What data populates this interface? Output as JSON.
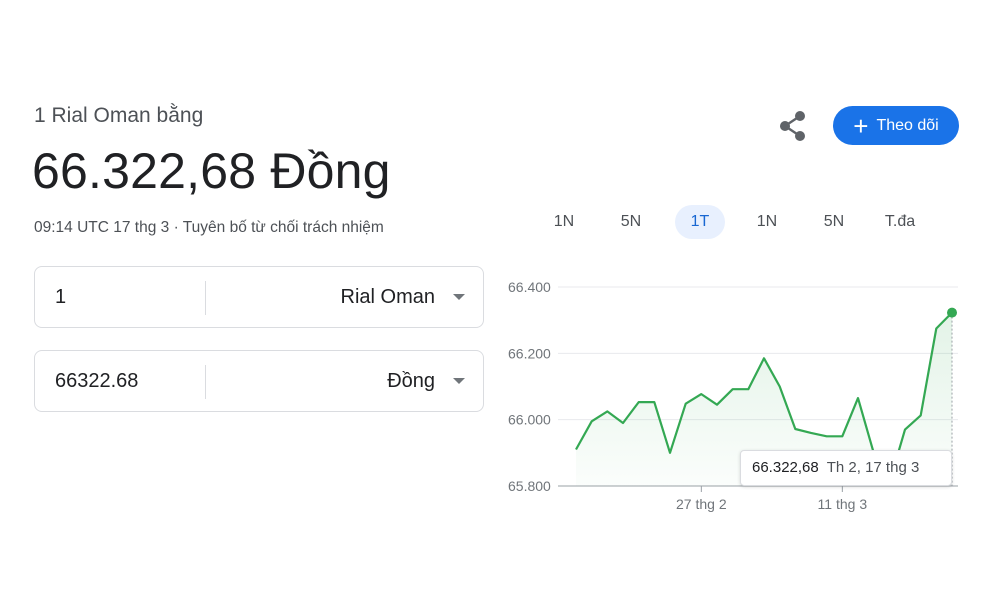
{
  "header": {
    "subtitle": "1 Rial Oman bằng",
    "result": "66.322,68 Đồng",
    "meta": "09:14 UTC 17 thg 3 · Tuyên bố từ chối trách nhiệm",
    "follow_label": "Theo dõi",
    "follow_icon": "plus-icon",
    "share_icon": "share-icon"
  },
  "converter": {
    "from": {
      "value": "1",
      "currency": "Rial Oman"
    },
    "to": {
      "value": "66322.68",
      "currency": "Đồng"
    }
  },
  "ranges": [
    {
      "label": "1N",
      "active": false
    },
    {
      "label": "5N",
      "active": false
    },
    {
      "label": "1T",
      "active": true
    },
    {
      "label": "1N",
      "active": false
    },
    {
      "label": "5N",
      "active": false
    },
    {
      "label": "T.đa",
      "active": false
    }
  ],
  "tooltip": {
    "value": "66.322,68",
    "date": "Th 2, 17 thg 3"
  },
  "colors": {
    "line": "#34a853",
    "accent": "#1a73e8"
  },
  "chart_data": {
    "type": "line",
    "ylim": [
      65800,
      66400
    ],
    "yticks": [
      65800,
      66000,
      66200,
      66400
    ],
    "ytick_labels": [
      "65.800",
      "66.000",
      "66.200",
      "66.400"
    ],
    "xticks": [
      {
        "index": 8,
        "label": "27 thg 2"
      },
      {
        "index": 17,
        "label": "11 thg 3"
      }
    ],
    "grid": true,
    "series": [
      {
        "values": [
          65910,
          65995,
          66025,
          65990,
          66053,
          66053,
          65900,
          66048,
          66077,
          66045,
          66092,
          66092,
          66185,
          66100,
          65972,
          65960,
          65950,
          65950,
          66065,
          65900,
          65808,
          65970,
          66013,
          66275,
          66322.68
        ]
      }
    ]
  }
}
